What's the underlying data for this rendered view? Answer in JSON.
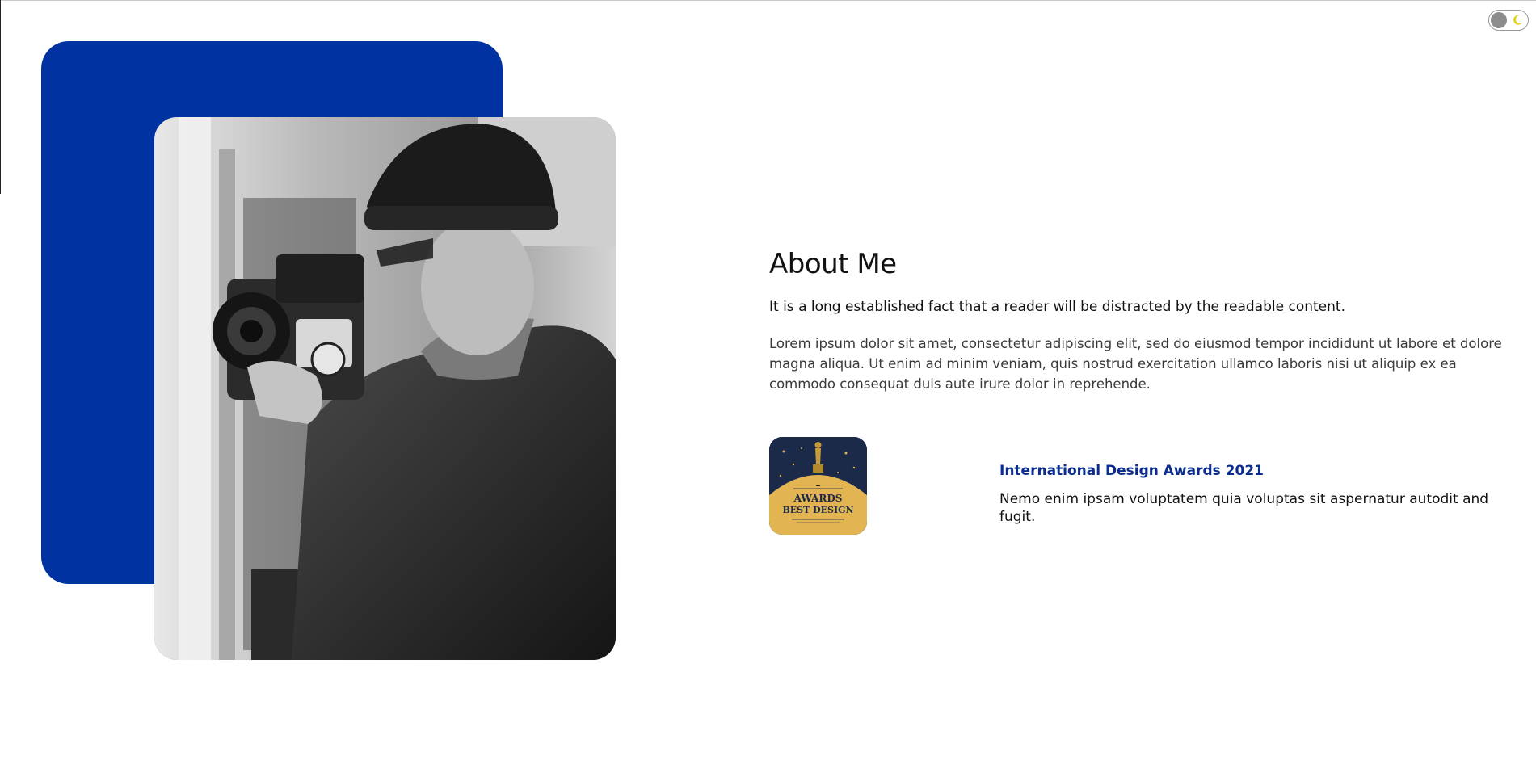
{
  "about": {
    "title": "About Me",
    "lead": "It is a long established fact that a reader will be distracted by the readable content.",
    "body": "Lorem ipsum dolor sit amet, consectetur adipiscing elit, sed do eiusmod tempor incididunt ut labore et dolore magna aliqua. Ut enim ad minim veniam, quis nostrud exercitation ullamco laboris nisi ut aliquip ex ea commodo consequat duis aute irure dolor in reprehende."
  },
  "award": {
    "badge_line1": "AWARDS",
    "badge_line2": "BEST DESIGN",
    "title": "International Design Awards 2021",
    "description": "Nemo enim ipsam voluptatem quia voluptas sit aspernatur autodit and fugit."
  },
  "theme_toggle": {
    "state": "light",
    "icon": "moon-icon"
  },
  "colors": {
    "accent_blue": "#0033a1",
    "award_title": "#0a2d8f",
    "badge_gold": "#e2b552",
    "badge_navy": "#1c2a4a"
  },
  "photo": {
    "subject": "photographer-with-camera",
    "style": "black-and-white"
  }
}
